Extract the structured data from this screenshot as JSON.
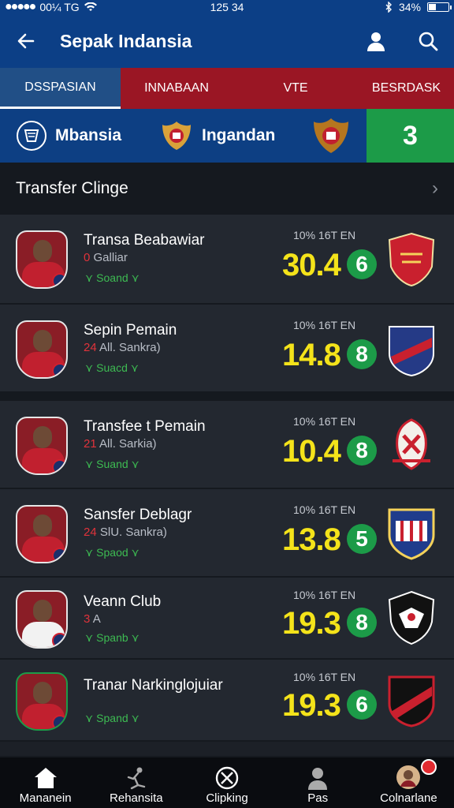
{
  "status_bar": {
    "carrier": "00¼ TG",
    "time": "125 34",
    "battery": "34%",
    "battery_level": 0.34
  },
  "header": {
    "title": "Sepak Indansia"
  },
  "tabs": [
    {
      "label": "DSSPASIAN",
      "active": true
    },
    {
      "label": "INNABAAN",
      "active": false
    },
    {
      "label": "VTE",
      "active": false
    },
    {
      "label": "BESRDASK",
      "active": false
    }
  ],
  "match": {
    "team1": "Mbansia",
    "team2": "Ingandan",
    "score": "3"
  },
  "section": {
    "title": "Transfer Clinge"
  },
  "players": [
    {
      "name": "Transa Beabawiar",
      "sub_num": "0",
      "sub_text": "Galliar",
      "squad": "Soand",
      "meta": "10% 16T EN",
      "value": "30.4",
      "rating": "6"
    },
    {
      "name": "Sepin Pemain",
      "sub_num": "24",
      "sub_text": "All. Sankra)",
      "squad": "Suacd",
      "meta": "10% 16T EN",
      "value": "14.8",
      "rating": "8"
    },
    {
      "name": "Transfee t Pemain",
      "sub_num": "21",
      "sub_text": "All. Sarkia)",
      "squad": "Suand",
      "meta": "10% 16T EN",
      "value": "10.4",
      "rating": "8"
    },
    {
      "name": "Sansfer Deblagr",
      "sub_num": "24",
      "sub_text": "SlU. Sankra)",
      "squad": "Spaod",
      "meta": "10% 16T EN",
      "value": "13.8",
      "rating": "5"
    },
    {
      "name": "Veann Club",
      "sub_num": "3",
      "sub_text": "A",
      "squad": "Spanb",
      "meta": "10% 16T EN",
      "value": "19.3",
      "rating": "8"
    },
    {
      "name": "Tranar Narkinglojuiar",
      "sub_num": "",
      "sub_text": "",
      "squad": "Spand",
      "meta": "10% 16T EN",
      "value": "19.3",
      "rating": "6"
    }
  ],
  "bottom_nav": [
    {
      "label": "Mananein",
      "icon": "home-icon"
    },
    {
      "label": "Rehansita",
      "icon": "player-kick-icon"
    },
    {
      "label": "Clipking",
      "icon": "ball-icon"
    },
    {
      "label": "Pas",
      "icon": "person-icon"
    },
    {
      "label": "Colnarlane",
      "icon": "avatar-icon"
    }
  ],
  "colors": {
    "primary": "#0c3f86",
    "tab_red": "#9a1624",
    "accent_green": "#1c9b48",
    "value_yellow": "#f4e31a",
    "card": "#232830"
  }
}
